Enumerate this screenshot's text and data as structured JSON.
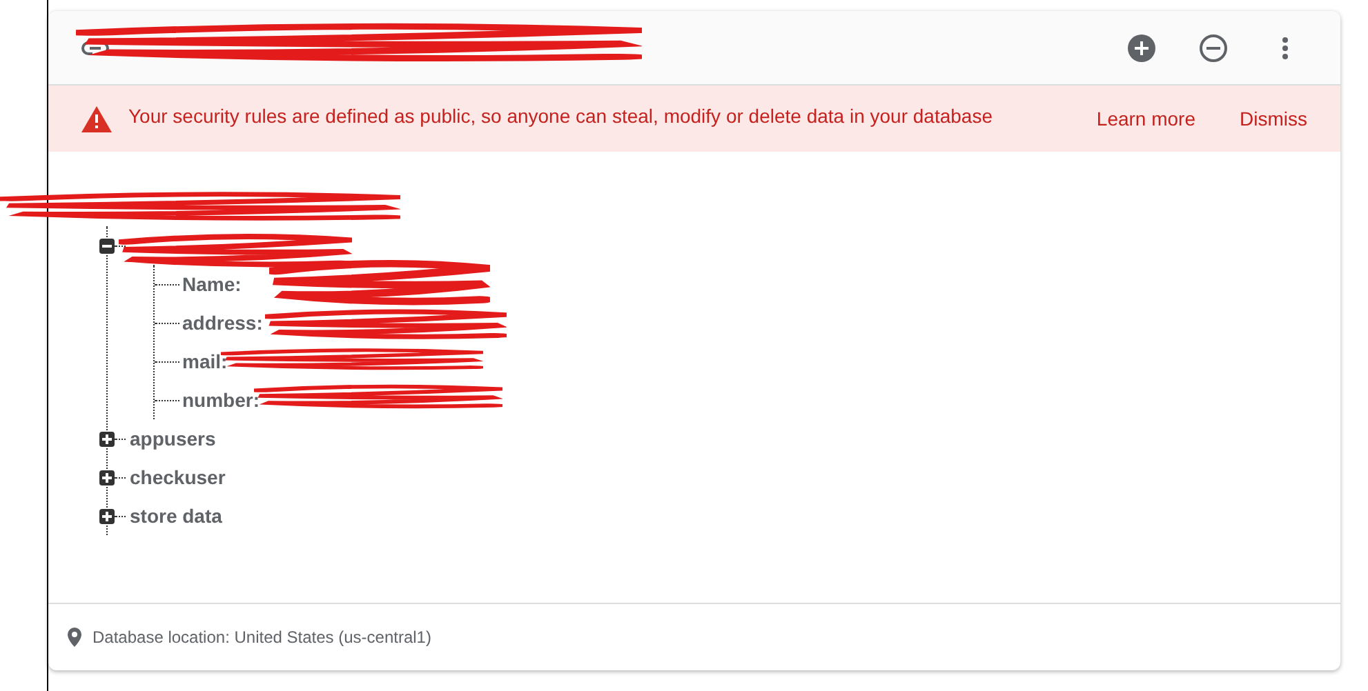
{
  "banner": {
    "message": "Your security rules are defined as public, so anyone can steal, modify or delete data in your database",
    "actions": [
      "Learn more",
      "Dismiss"
    ]
  },
  "tree": {
    "nodes": [
      {
        "expanded": true,
        "children": [
          {
            "key": "Name:"
          },
          {
            "key": "address:"
          },
          {
            "key": "mail:"
          },
          {
            "key": "number:"
          }
        ]
      },
      {
        "key": "appusers",
        "expanded": false
      },
      {
        "key": "checkuser",
        "expanded": false
      },
      {
        "key": "store data",
        "expanded": false
      }
    ]
  },
  "footer": {
    "location": "Database location: United States (us-central1)"
  }
}
